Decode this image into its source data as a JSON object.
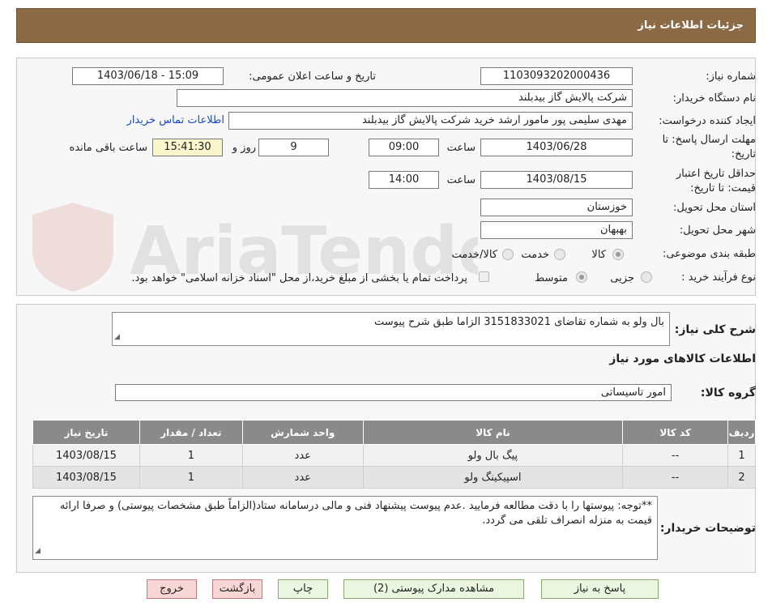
{
  "header": {
    "title": "جزئیات اطلاعات نیاز"
  },
  "fields": {
    "need_number_label": "شماره نیاز:",
    "need_number_value": "1103093202000436",
    "announce_label": "تاریخ و ساعت اعلان عمومی:",
    "announce_value": "1403/06/18 - 15:09",
    "buyer_org_label": "نام دستگاه خریدار:",
    "buyer_org_value": "شرکت پالایش گاز بیدبلند",
    "requester_label": "ایجاد کننده درخواست:",
    "requester_value": "مهدی سلیمی پور مامور ارشد خرید شرکت پالایش گاز بیدبلند",
    "contact_link": "اطلاعات تماس خریدار",
    "deadline_label_1": "مهلت ارسال پاسخ: تا",
    "deadline_label_2": "تاریخ:",
    "deadline_date": "1403/06/28",
    "time_label": "ساعت",
    "deadline_time": "09:00",
    "days_value": "9",
    "days_label": "روز و",
    "remaining_time": "15:41:30",
    "remaining_label": "ساعت باقی مانده",
    "validity_label_1": "حداقل تاریخ اعتبار",
    "validity_label_2": "قیمت: تا تاریخ:",
    "validity_date": "1403/08/15",
    "validity_time": "14:00",
    "province_label": "استان محل تحویل:",
    "province_value": "خوزستان",
    "city_label": "شهر محل تحویل:",
    "city_value": "بهبهان",
    "category_label": "طبقه بندی موضوعی:",
    "category_options": [
      "کالا",
      "خدمت",
      "کالا/خدمت"
    ],
    "process_label": "نوع فرآیند خرید :",
    "process_options": [
      "جزیی",
      "متوسط"
    ],
    "payment_note": "پرداخت تمام یا بخشی از مبلغ خرید،از محل \"اسناد خزانه اسلامی\" خواهد بود."
  },
  "description": {
    "label": "شرح کلی نیاز:",
    "value": "بال ولو  به شماره تقاضای 3151833021 الزاما طبق شرح پیوست"
  },
  "goods": {
    "section_title": "اطلاعات کالاهای مورد نیاز",
    "group_label": "گروه کالا:",
    "group_value": "امور تاسیساتی",
    "columns": [
      "ردیف",
      "کد کالا",
      "نام کالا",
      "واحد شمارش",
      "تعداد / مقدار",
      "تاریخ نیاز"
    ],
    "rows": [
      [
        "1",
        "--",
        "پیگ بال ولو",
        "عدد",
        "1",
        "1403/08/15"
      ],
      [
        "2",
        "--",
        "اسپیکینگ ولو",
        "عدد",
        "1",
        "1403/08/15"
      ]
    ]
  },
  "buyer_notes": {
    "label": "توضیحات خریدار:",
    "value": "**توجه: پیوستها را با دقت مطالعه فرمایید .عدم پیوست پیشنهاد فنی و مالی درسامانه ستاد(الزاماً طبق مشخصات پیوستی) و صرفا ارائه قیمت به منزله انصراف تلقی می گردد."
  },
  "buttons": {
    "reply": "پاسخ به نیاز",
    "attachments": "مشاهده مدارک پیوستی (2)",
    "print": "چاپ",
    "back": "بازگشت",
    "exit": "خروج"
  },
  "watermark": {
    "text": "AriaTender.neT"
  },
  "colors": {
    "header_bg": "#8b6a45",
    "link": "#1a49c4",
    "button_green": "#eaf6e0",
    "button_red": "#f9d6d6"
  }
}
